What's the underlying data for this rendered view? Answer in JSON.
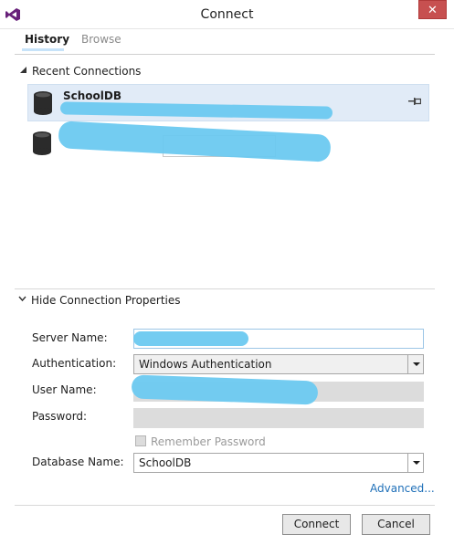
{
  "window": {
    "title": "Connect",
    "close_glyph": "✕"
  },
  "tabs": [
    {
      "label": "History",
      "active": true
    },
    {
      "label": "Browse",
      "active": false
    }
  ],
  "recent": {
    "heading": "Recent Connections",
    "items": [
      {
        "name": "SchoolDB",
        "detail": "",
        "icon": "database-icon",
        "pinned_icon": "pin-icon"
      },
      {
        "name": "",
        "detail": "",
        "icon": "database-icon"
      }
    ]
  },
  "properties": {
    "heading": "Hide Connection Properties",
    "server_label": "Server Name:",
    "server_value": "",
    "auth_label": "Authentication:",
    "auth_value": "Windows Authentication",
    "user_label": "User Name:",
    "user_value": "",
    "password_label": "Password:",
    "password_value": "",
    "remember_label": "Remember Password",
    "remember_checked": false,
    "db_label": "Database Name:",
    "db_value": "SchoolDB",
    "advanced_link": "Advanced..."
  },
  "buttons": {
    "connect": "Connect",
    "cancel": "Cancel"
  },
  "colors": {
    "accent": "#1e6fb8",
    "selection": "#e1ebf7",
    "close": "#c75050",
    "redaction": "#6cc9f0"
  }
}
